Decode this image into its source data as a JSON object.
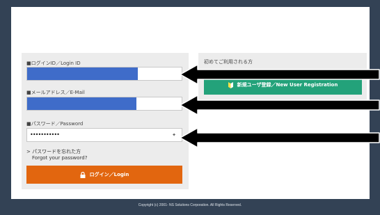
{
  "login": {
    "id_label": "■ログインID／Login ID",
    "email_label": "■メールアドレス／E-Mail",
    "password_label": "■パスワード／Password",
    "password_value": "•••••••••••",
    "forgot_ja": "> パスワードを忘れた方",
    "forgot_en": "Forgot your password?",
    "login_button": "ログイン／Login"
  },
  "first_time": {
    "title": "初めてご利用される方",
    "register_button": "新規ユーザ登録／New User Registration"
  },
  "footer": {
    "copyright": "Copyright (c) 2001- NS Solutions Corporation. All Rights Reserved."
  },
  "colors": {
    "background": "#334255",
    "redaction": "#3f6cc9",
    "login_button": "#e2660f",
    "register_button": "#23a27a",
    "annotation_arrow": "#000000"
  },
  "icons": {
    "login": "lock-icon",
    "register": "beginner-mark-icon",
    "password_reveal": "eye-icon",
    "annotation": "arrow-left-icon"
  }
}
